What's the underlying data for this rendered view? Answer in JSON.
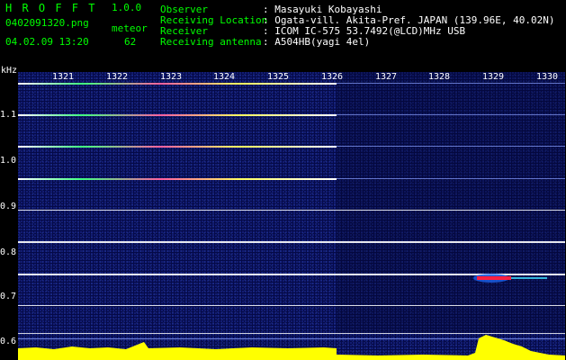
{
  "header": {
    "logo": "H R O F F T",
    "version": "1.0.0",
    "filename": "0402091320.png",
    "mode": "meteor",
    "datetime": "04.02.09 13:20",
    "count": "62",
    "labels": {
      "observer": "Observer",
      "location": "Receiving Location",
      "receiver": "Receiver",
      "antenna": "Receiving antenna"
    },
    "values": {
      "observer": ": Masayuki Kobayashi",
      "location": ": Ogata-vill. Akita-Pref. JAPAN (139.96E, 40.02N)",
      "receiver": ": ICOM IC-575 53.7492(@LCD)MHz USB",
      "antenna": ": A504HB(yagi 4el)"
    }
  },
  "axes": {
    "y_unit": "kHz",
    "y_ticks": [
      "1.1",
      "1.0",
      "0.9",
      "0.8",
      "0.7",
      "0.6"
    ],
    "x_ticks": [
      "1321",
      "1322",
      "1323",
      "1324",
      "1325",
      "1326",
      "1327",
      "1328",
      "1329",
      "1330"
    ]
  },
  "colors": {
    "background": "#050a48",
    "label_green": "#00ff00",
    "signal_white": "#ffffff",
    "echo_red": "#ff2040",
    "power_yellow": "#ffff00"
  }
}
